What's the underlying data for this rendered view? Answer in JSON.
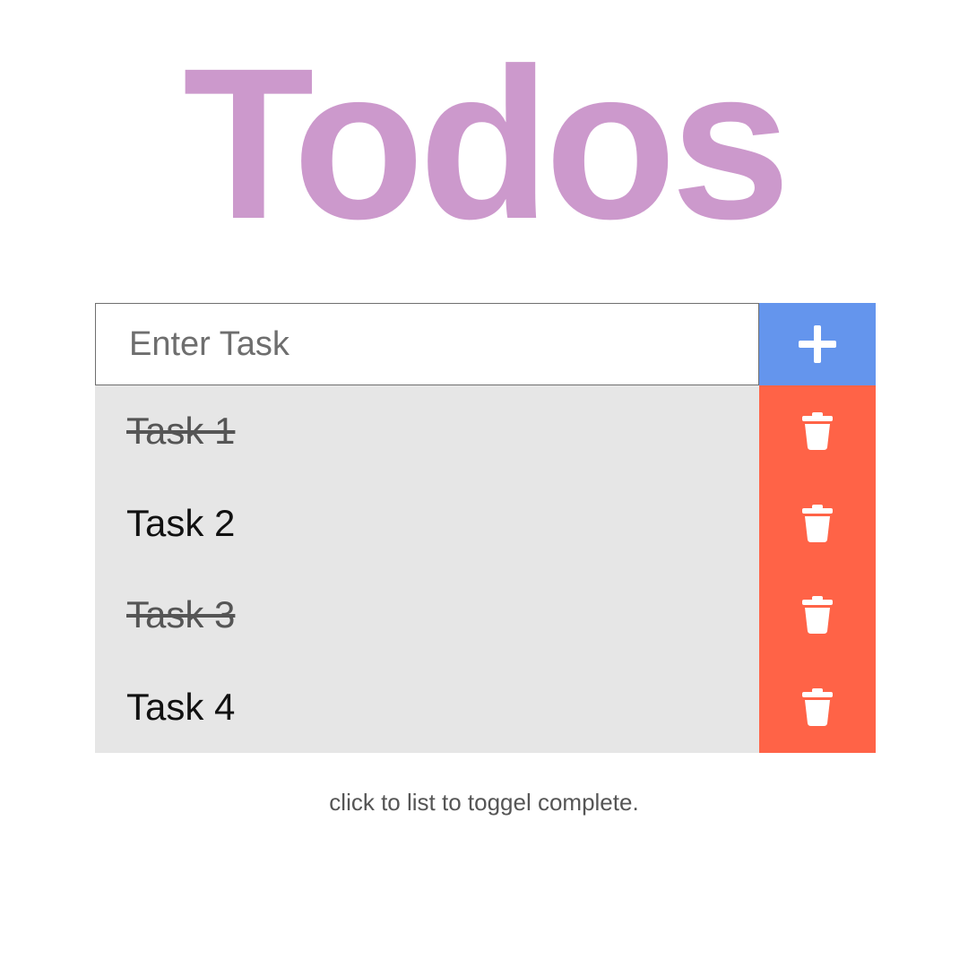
{
  "header": {
    "title": "Todos"
  },
  "form": {
    "placeholder": "Enter Task",
    "add_icon": "plus-icon"
  },
  "tasks": [
    {
      "label": "Task 1",
      "completed": true
    },
    {
      "label": "Task 2",
      "completed": false
    },
    {
      "label": "Task 3",
      "completed": true
    },
    {
      "label": "Task 4",
      "completed": false
    }
  ],
  "delete_icon": "trash-icon",
  "footer": {
    "hint": "click to list to toggel complete."
  },
  "colors": {
    "title": "#cc99cc",
    "add_button": "#6495ed",
    "delete_button": "#ff6347",
    "task_background": "#e6e6e6"
  }
}
